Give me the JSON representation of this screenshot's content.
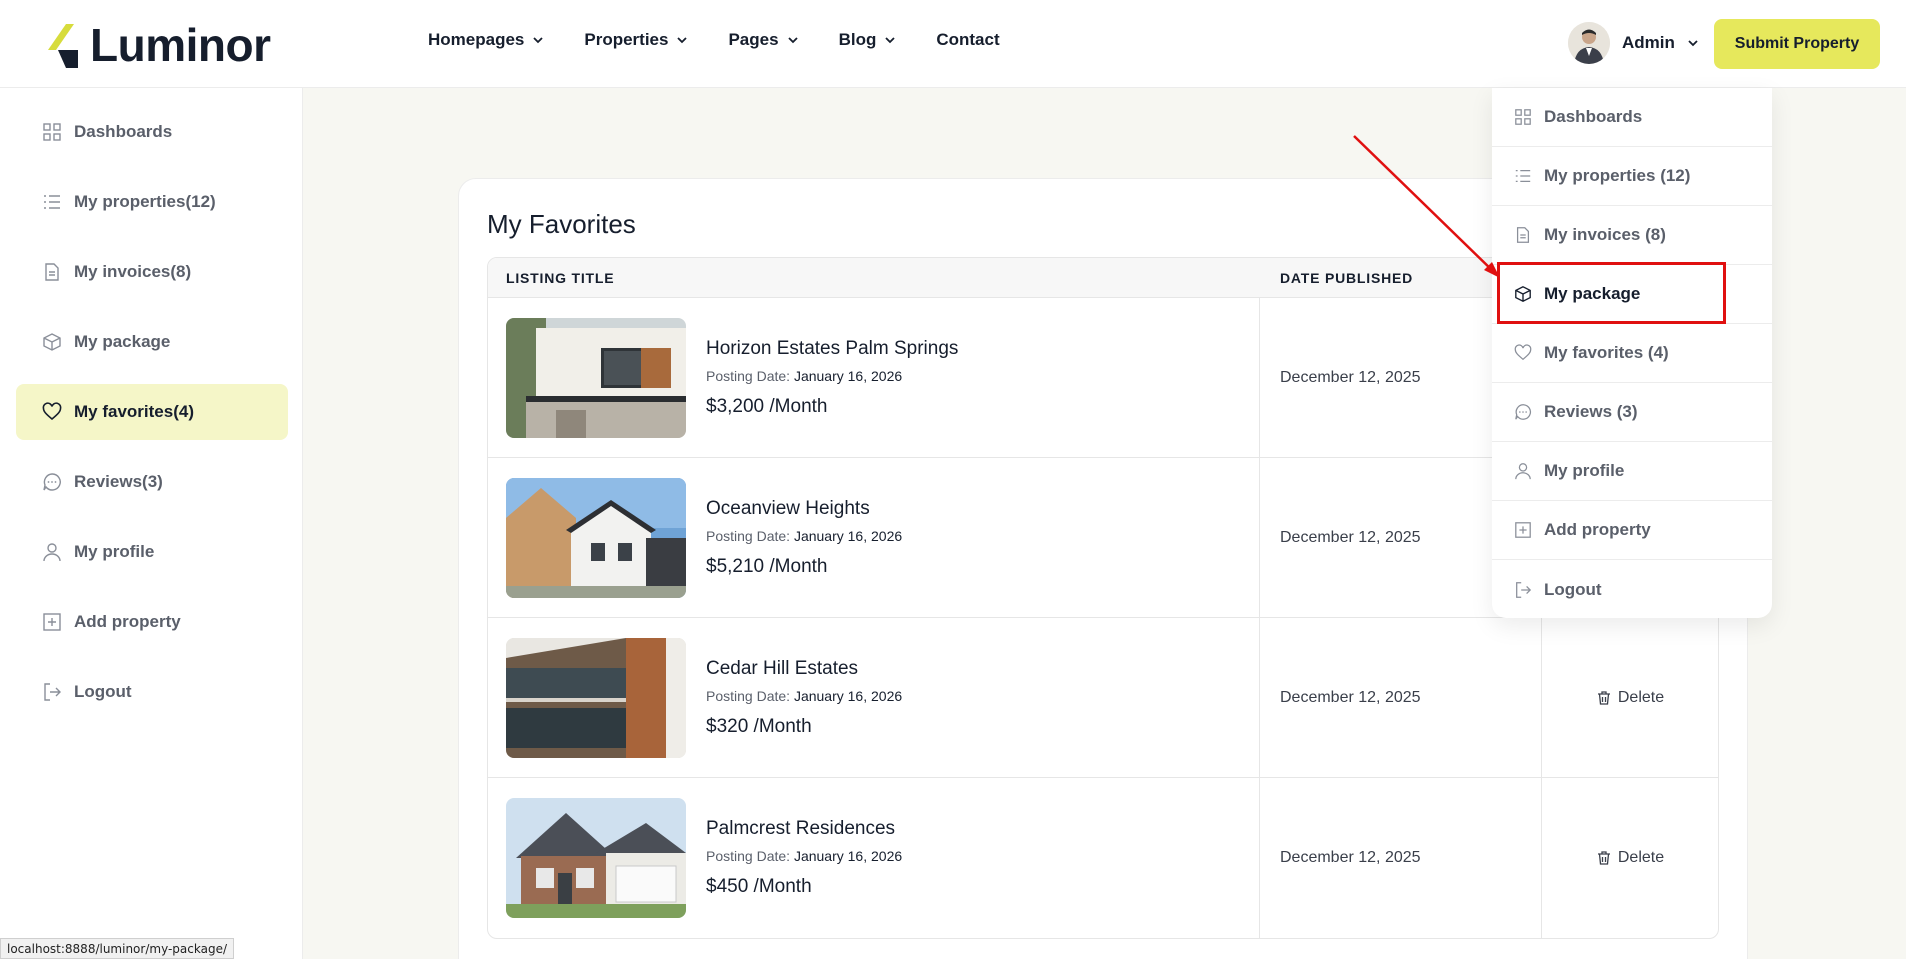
{
  "header": {
    "logo_text": "Luminor",
    "nav": [
      {
        "label": "Homepages",
        "has_dropdown": true
      },
      {
        "label": "Properties",
        "has_dropdown": true
      },
      {
        "label": "Pages",
        "has_dropdown": true
      },
      {
        "label": "Blog",
        "has_dropdown": true
      },
      {
        "label": "Contact",
        "has_dropdown": false
      }
    ],
    "admin_label": "Admin",
    "submit_label": "Submit Property"
  },
  "sidebar": {
    "items": [
      {
        "label": "Dashboards",
        "icon": "grid-icon"
      },
      {
        "label": "My properties(12)",
        "icon": "list-icon"
      },
      {
        "label": "My invoices(8)",
        "icon": "file-icon"
      },
      {
        "label": "My package",
        "icon": "package-icon"
      },
      {
        "label": "My favorites(4)",
        "icon": "heart-icon",
        "active": true
      },
      {
        "label": "Reviews(3)",
        "icon": "chat-icon"
      },
      {
        "label": "My profile",
        "icon": "user-icon"
      },
      {
        "label": "Add property",
        "icon": "plus-square-icon"
      },
      {
        "label": "Logout",
        "icon": "logout-icon"
      }
    ]
  },
  "main": {
    "title": "My Favorites",
    "columns": [
      "LISTING TITLE",
      "DATE PUBLISHED"
    ],
    "rows": [
      {
        "title": "Horizon Estates Palm Springs",
        "posting_label": "Posting Date:",
        "posting_date": "January 16, 2026",
        "price": "$3,200 /Month",
        "date_published": "December 12, 2025",
        "action": ""
      },
      {
        "title": "Oceanview Heights",
        "posting_label": "Posting Date:",
        "posting_date": "January 16, 2026",
        "price": "$5,210 /Month",
        "date_published": "December 12, 2025",
        "action": ""
      },
      {
        "title": "Cedar Hill Estates",
        "posting_label": "Posting Date:",
        "posting_date": "January 16, 2026",
        "price": "$320 /Month",
        "date_published": "December 12, 2025",
        "action": "Delete"
      },
      {
        "title": "Palmcrest Residences",
        "posting_label": "Posting Date:",
        "posting_date": "January 16, 2026",
        "price": "$450 /Month",
        "date_published": "December 12, 2025",
        "action": "Delete"
      }
    ]
  },
  "dropdown": {
    "items": [
      {
        "label": "Dashboards",
        "icon": "grid-icon"
      },
      {
        "label": "My properties (12)",
        "icon": "list-icon"
      },
      {
        "label": "My invoices (8)",
        "icon": "file-icon"
      },
      {
        "label": "My package",
        "icon": "package-icon",
        "highlighted": true
      },
      {
        "label": "My favorites (4)",
        "icon": "heart-icon"
      },
      {
        "label": "Reviews (3)",
        "icon": "chat-icon"
      },
      {
        "label": "My profile",
        "icon": "user-icon"
      },
      {
        "label": "Add property",
        "icon": "plus-square-icon"
      },
      {
        "label": "Logout",
        "icon": "logout-icon"
      }
    ]
  },
  "status_bar": {
    "url": "localhost:8888/luminor/my-package/"
  },
  "colors": {
    "accent": "#e6e85c",
    "active_bg": "#f5f6c8",
    "annotation": "#e01010",
    "text": "#161e2d"
  }
}
